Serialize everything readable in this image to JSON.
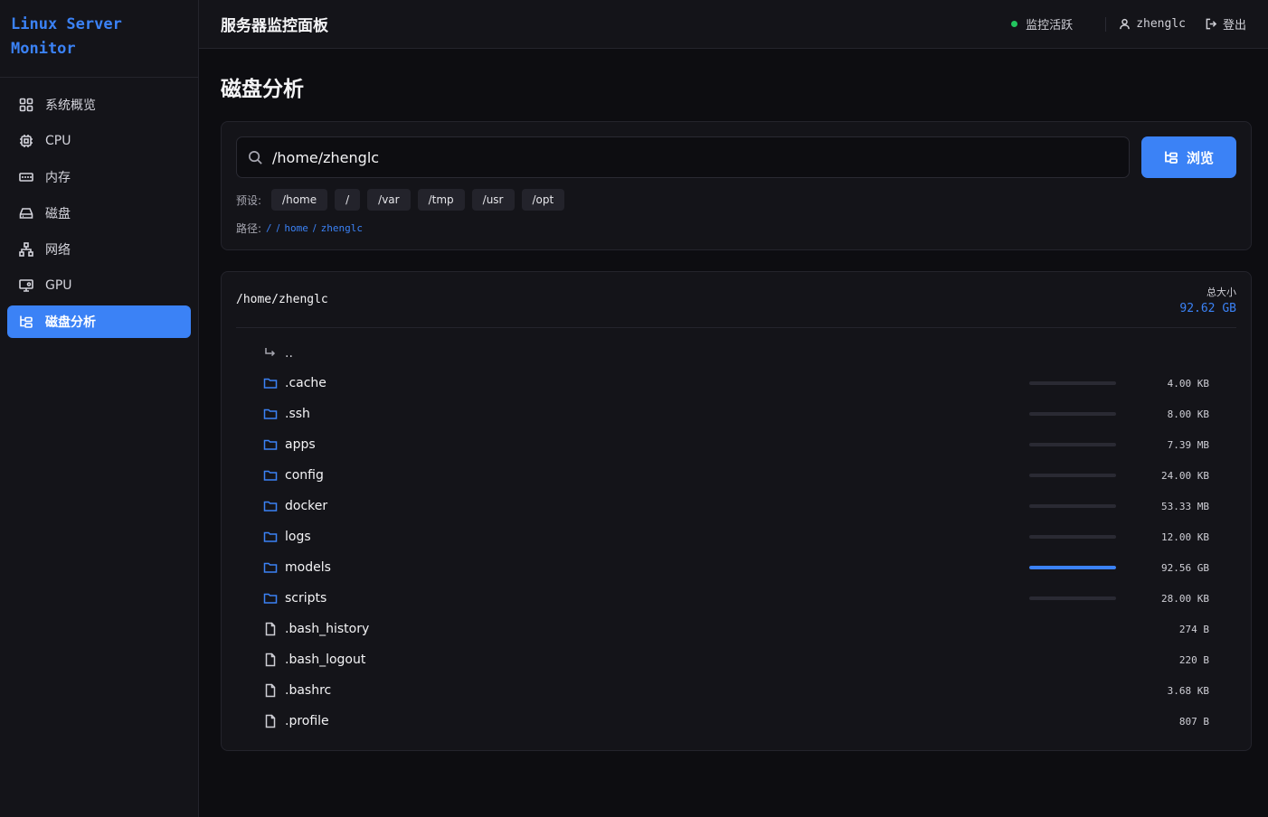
{
  "brand": {
    "line1": "Linux Server",
    "line2": "Monitor"
  },
  "sidebar": {
    "items": [
      {
        "label": "系统概览",
        "icon": "grid-icon"
      },
      {
        "label": "CPU",
        "icon": "cpu-icon"
      },
      {
        "label": "内存",
        "icon": "memory-icon"
      },
      {
        "label": "磁盘",
        "icon": "disk-icon"
      },
      {
        "label": "网络",
        "icon": "network-icon"
      },
      {
        "label": "GPU",
        "icon": "gpu-icon"
      },
      {
        "label": "磁盘分析",
        "icon": "disk-analysis-icon",
        "active": true
      }
    ]
  },
  "header": {
    "title": "服务器监控面板",
    "status": "监控活跃",
    "username": "zhenglc",
    "logout": "登出"
  },
  "page": {
    "title": "磁盘分析"
  },
  "search": {
    "value": "/home/zhenglc",
    "browse_label": "浏览",
    "presets_label": "预设:",
    "presets": [
      "/home",
      "/",
      "/var",
      "/tmp",
      "/usr",
      "/opt"
    ],
    "path_label": "路径:",
    "crumbs": [
      "/",
      "home",
      "zhenglc"
    ]
  },
  "listing": {
    "path": "/home/zhenglc",
    "total_label": "总大小",
    "total_value": "92.62 GB",
    "parent": "..",
    "entries": [
      {
        "name": ".cache",
        "type": "folder",
        "size": "4.00 KB",
        "fraction": 0.0
      },
      {
        "name": ".ssh",
        "type": "folder",
        "size": "8.00 KB",
        "fraction": 0.0
      },
      {
        "name": "apps",
        "type": "folder",
        "size": "7.39 MB",
        "fraction": 0.0001
      },
      {
        "name": "config",
        "type": "folder",
        "size": "24.00 KB",
        "fraction": 0.0
      },
      {
        "name": "docker",
        "type": "folder",
        "size": "53.33 MB",
        "fraction": 0.0006
      },
      {
        "name": "logs",
        "type": "folder",
        "size": "12.00 KB",
        "fraction": 0.0
      },
      {
        "name": "models",
        "type": "folder",
        "size": "92.56 GB",
        "fraction": 0.999
      },
      {
        "name": "scripts",
        "type": "folder",
        "size": "28.00 KB",
        "fraction": 0.0
      },
      {
        "name": ".bash_history",
        "type": "file",
        "size": "274 B"
      },
      {
        "name": ".bash_logout",
        "type": "file",
        "size": "220 B"
      },
      {
        "name": ".bashrc",
        "type": "file",
        "size": "3.68 KB"
      },
      {
        "name": ".profile",
        "type": "file",
        "size": "807 B"
      }
    ]
  },
  "colors": {
    "accent": "#3b82f6",
    "status": "#22c55e",
    "background": "#0d0d11",
    "panel": "#141419"
  }
}
